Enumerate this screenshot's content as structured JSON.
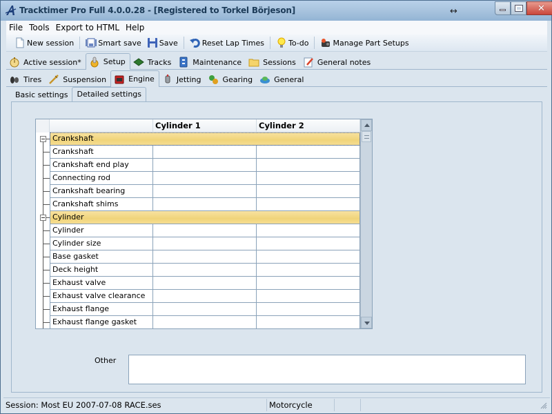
{
  "window": {
    "title": "Tracktimer Pro Full 4.0.0.28  - [Registered to Torkel Börjeson]",
    "icons": {
      "logo": "tracktimer-logo-icon",
      "resize": "resize-arrows-icon"
    },
    "controls": {
      "minimize": "minimize",
      "maximize": "maximize",
      "close": "close"
    }
  },
  "menu": {
    "items": [
      {
        "label": "File"
      },
      {
        "label": "Tools"
      },
      {
        "label": "Export to HTML"
      },
      {
        "label": "Help"
      }
    ]
  },
  "toolbar": {
    "buttons": [
      {
        "label": "New session",
        "icon": "new-document-icon"
      },
      {
        "label": "Smart save",
        "icon": "smart-save-icon"
      },
      {
        "label": "Save",
        "icon": "floppy-save-icon"
      },
      {
        "label": "Reset Lap Times",
        "icon": "reset-arrow-icon"
      },
      {
        "label": "To-do",
        "icon": "lightbulb-icon"
      },
      {
        "label": "Manage Part Setups",
        "icon": "parts-icon"
      }
    ]
  },
  "main_tabs": [
    {
      "label": "Active session*",
      "icon": "stopwatch-icon",
      "active": false
    },
    {
      "label": "Setup",
      "icon": "setup-gear-icon",
      "active": true
    },
    {
      "label": "Tracks",
      "icon": "track-icon",
      "active": false
    },
    {
      "label": "Maintenance",
      "icon": "maintenance-icon",
      "active": false
    },
    {
      "label": "Sessions",
      "icon": "folder-icon",
      "active": false
    },
    {
      "label": "General notes",
      "icon": "notes-pencil-icon",
      "active": false
    }
  ],
  "setup_tabs": [
    {
      "label": "Tires",
      "icon": "tires-icon",
      "active": false
    },
    {
      "label": "Suspension",
      "icon": "suspension-icon",
      "active": false
    },
    {
      "label": "Engine",
      "icon": "engine-icon",
      "active": true
    },
    {
      "label": "Jetting",
      "icon": "carburetor-icon",
      "active": false
    },
    {
      "label": "Gearing",
      "icon": "gears-icon",
      "active": false
    },
    {
      "label": "General",
      "icon": "general-icon",
      "active": false
    }
  ],
  "engine_tabs": [
    {
      "label": "Basic settings",
      "active": false
    },
    {
      "label": "Detailed settings",
      "active": true
    }
  ],
  "grid": {
    "columns": [
      "",
      "Cylinder 1",
      "Cylinder 2"
    ],
    "groups": [
      {
        "name": "Crankshaft",
        "selected": true,
        "rows": [
          {
            "name": "Crankshaft",
            "cyl1": "",
            "cyl2": ""
          },
          {
            "name": "Crankshaft end play",
            "cyl1": "",
            "cyl2": ""
          },
          {
            "name": "Connecting rod",
            "cyl1": "",
            "cyl2": ""
          },
          {
            "name": "Crankshaft bearing",
            "cyl1": "",
            "cyl2": ""
          },
          {
            "name": "Crankshaft shims",
            "cyl1": "",
            "cyl2": ""
          }
        ]
      },
      {
        "name": "Cylinder",
        "selected": false,
        "rows": [
          {
            "name": "Cylinder",
            "cyl1": "",
            "cyl2": ""
          },
          {
            "name": "Cylinder size",
            "cyl1": "",
            "cyl2": ""
          },
          {
            "name": "Base gasket",
            "cyl1": "",
            "cyl2": ""
          },
          {
            "name": "Deck height",
            "cyl1": "",
            "cyl2": ""
          },
          {
            "name": "Exhaust valve",
            "cyl1": "",
            "cyl2": ""
          },
          {
            "name": "Exhaust valve clearance",
            "cyl1": "",
            "cyl2": ""
          },
          {
            "name": "Exhaust flange",
            "cyl1": "",
            "cyl2": ""
          },
          {
            "name": "Exhaust flange gasket",
            "cyl1": "",
            "cyl2": ""
          }
        ]
      }
    ]
  },
  "other": {
    "label": "Other",
    "value": ""
  },
  "status": {
    "session": "Session: Most EU 2007-07-08 RACE.ses",
    "vehicle_type": "Motorcycle",
    "extra1": "",
    "extra2": ""
  }
}
